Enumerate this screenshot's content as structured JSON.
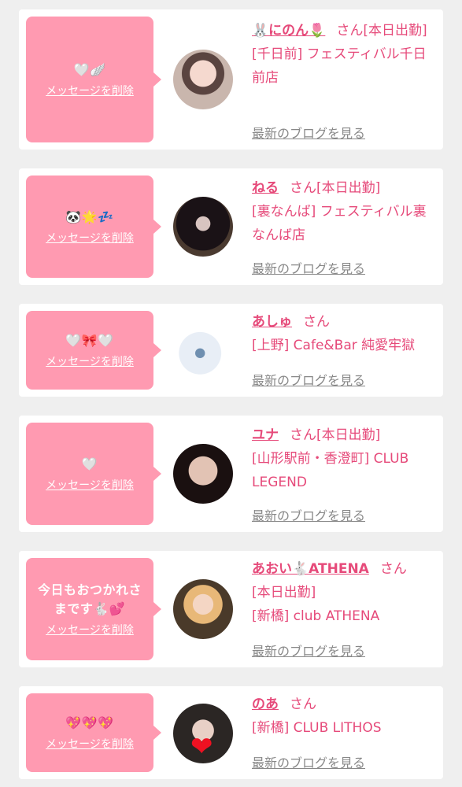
{
  "cards": [
    {
      "message": "🤍🪽",
      "delete_label": "メッセージを削除",
      "name": "🐰にのん🌷",
      "san": "さん",
      "status": "[本日出勤]",
      "location": "[千日前] フェスティバル千日前店",
      "blog_label": "最新のブログを見る",
      "avatar": "avatar-woman-1"
    },
    {
      "message": "🐼🌟💤",
      "delete_label": "メッセージを削除",
      "name": "ねる",
      "san": "さん",
      "status": "[本日出勤]",
      "location": "[裏なんば] フェスティバル裏なんば店",
      "blog_label": "最新のブログを見る",
      "avatar": "avatar-woman-2"
    },
    {
      "message": "🤍🎀🤍",
      "delete_label": "メッセージを削除",
      "name": "あしゅ",
      "san": "さん",
      "status": "",
      "location": "[上野] Cafe&Bar 純愛牢獄",
      "blog_label": "最新のブログを見る",
      "avatar": "avatar-anime"
    },
    {
      "message": "🤍",
      "delete_label": "メッセージを削除",
      "name": "ユナ",
      "san": "さん",
      "status": "[本日出勤]",
      "location": "[山形駅前・香澄町] CLUB LEGEND",
      "blog_label": "最新のブログを見る",
      "avatar": "avatar-woman-4"
    },
    {
      "message": "今日もおつかれさまです🐇💕",
      "delete_label": "メッセージを削除",
      "name": "あおい🐇ATHENA",
      "san": "さん",
      "status": "[本日出勤]",
      "location": "[新橋] club ATHENA",
      "blog_label": "最新のブログを見る",
      "avatar": "avatar-woman-5"
    },
    {
      "message": "💖💖💖",
      "delete_label": "メッセージを削除",
      "name": "のあ",
      "san": "さん",
      "status": "",
      "location": "[新橋] CLUB LITHOS",
      "blog_label": "最新のブログを見る",
      "avatar": "avatar-woman-6",
      "avatar_sticker": "❤"
    }
  ]
}
